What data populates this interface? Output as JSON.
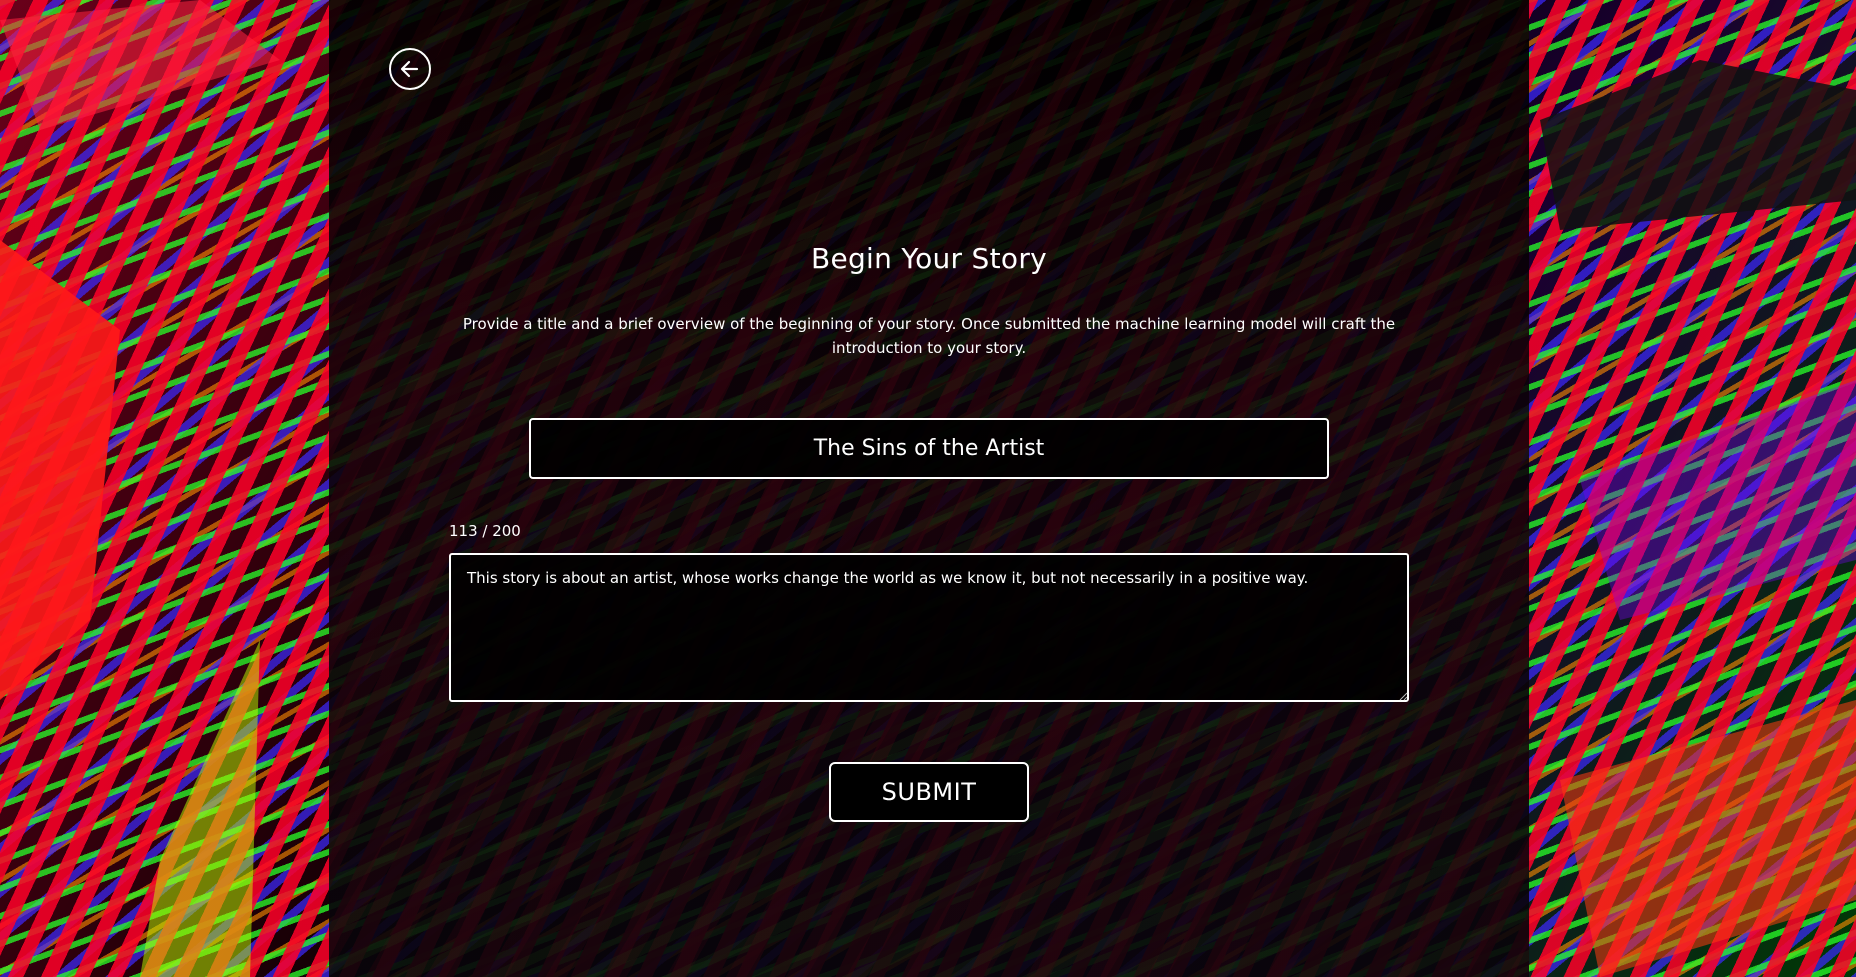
{
  "back": {
    "icon": "arrow-left-icon"
  },
  "heading": "Begin Your Story",
  "intro": "Provide a title and a brief overview of the beginning of your story. Once submitted the machine learning model will craft the introduction to your story.",
  "story_title": {
    "value": "The Sins of the Artist"
  },
  "overview": {
    "counter": "113 / 200",
    "value": "This story is about an artist, whose works change the world as we know it, but not necessarily in a positive way."
  },
  "submit_label": "SUBMIT",
  "colors": {
    "panel": "#0a0308",
    "accent_red": "#ff0028",
    "accent_green": "#28ff28",
    "accent_blue": "#3c28ff",
    "text": "#ffffff"
  }
}
